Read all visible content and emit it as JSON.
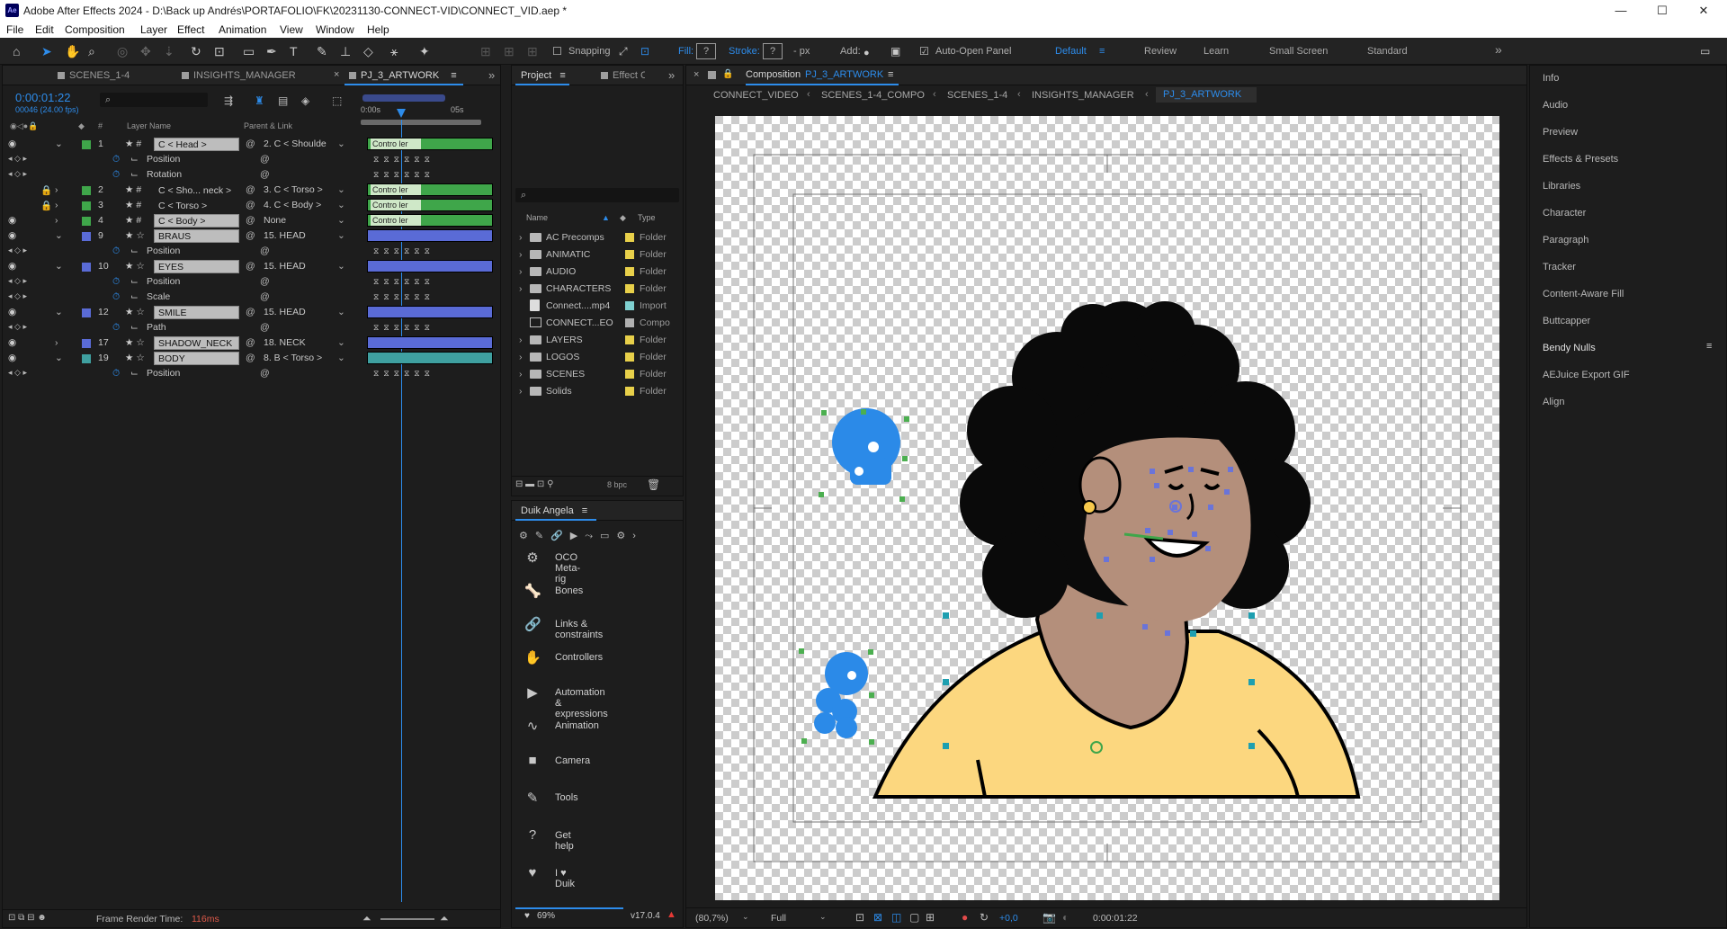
{
  "titlebar": {
    "app_icon": "Ae",
    "title": "Adobe After Effects 2024 - D:\\Back up Andrés\\PORTAFOLIO\\FK\\20231130-CONNECT-VID\\CONNECT_VID.aep *",
    "minimize": "—",
    "maximize": "☐",
    "close": "✕"
  },
  "menu": [
    "File",
    "Edit",
    "Composition",
    "Layer",
    "Effect",
    "Animation",
    "View",
    "Window",
    "Help"
  ],
  "toolbar": {
    "snapping": "Snapping",
    "fill": "Fill:",
    "fill_value": "?",
    "stroke": "Stroke:",
    "stroke_value": "?",
    "stroke_px": "- px",
    "add": "Add:",
    "auto_open": "Auto-Open Panel",
    "workspaces": [
      "Default",
      "Review",
      "Learn",
      "Small Screen",
      "Standard"
    ],
    "more": "»"
  },
  "timeline": {
    "tabs": [
      "SCENES_1-4",
      "INSIGHTS_MANAGER",
      "PJ_3_ARTWORK"
    ],
    "timecode": "0:00:01:22",
    "frame_info": "00046 (24.00 fps)",
    "col_layer_name": "Layer Name",
    "col_parent": "Parent & Link",
    "col_num": "#",
    "ruler": [
      "0:00s",
      "05s"
    ],
    "layers": [
      {
        "num": "1",
        "name": "C < Head >",
        "parent": "2. C < Shoulde",
        "type": "ctrl",
        "color": "#3fa64a",
        "bar": "Contro ler"
      },
      {
        "prop": "Position"
      },
      {
        "prop": "Rotation"
      },
      {
        "num": "2",
        "name": "C < Sho... neck >",
        "parent": "3. C < Torso >",
        "type": "ctrl",
        "color": "#3fa64a",
        "bar": "Contro ler",
        "plain": true
      },
      {
        "num": "3",
        "name": "C < Torso >",
        "parent": "4. C < Body >",
        "type": "ctrl",
        "color": "#3fa64a",
        "bar": "Contro ler",
        "plain": true
      },
      {
        "num": "4",
        "name": "C < Body >",
        "parent": "None",
        "type": "ctrl",
        "color": "#3fa64a",
        "bar": "Contro ler"
      },
      {
        "num": "9",
        "name": "BRAUS",
        "parent": "15. HEAD",
        "type": "shape",
        "color": "#5a6bd6"
      },
      {
        "prop": "Position"
      },
      {
        "num": "10",
        "name": "EYES",
        "parent": "15. HEAD",
        "type": "shape",
        "color": "#5a6bd6"
      },
      {
        "prop": "Position"
      },
      {
        "prop": "Scale"
      },
      {
        "num": "12",
        "name": "SMILE",
        "parent": "15. HEAD",
        "type": "shape",
        "color": "#5a6bd6"
      },
      {
        "prop": "Path"
      },
      {
        "num": "17",
        "name": "SHADOW_NECK",
        "parent": "18. NECK",
        "type": "shape",
        "color": "#5a6bd6"
      },
      {
        "num": "19",
        "name": "BODY",
        "parent": "8. B < Torso >",
        "type": "shape",
        "color": "#3fa0a0"
      },
      {
        "prop": "Position"
      }
    ],
    "footer": {
      "render_label": "Frame Render Time:",
      "render_value": "116ms"
    }
  },
  "project": {
    "tabs": [
      "Project",
      "Effect Controls"
    ],
    "search_placeholder": "",
    "col_name": "Name",
    "col_type": "Type",
    "items": [
      {
        "name": "AC Precomps",
        "type": "Folder",
        "color": "#e8d04a",
        "kind": "folder"
      },
      {
        "name": "ANIMATIC",
        "type": "Folder",
        "color": "#e8d04a",
        "kind": "folder"
      },
      {
        "name": "AUDIO",
        "type": "Folder",
        "color": "#e8d04a",
        "kind": "folder"
      },
      {
        "name": "CHARACTERS",
        "type": "Folder",
        "color": "#e8d04a",
        "kind": "folder"
      },
      {
        "name": "Connect....mp4",
        "type": "Import",
        "color": "#7fd0d0",
        "kind": "file"
      },
      {
        "name": "CONNECT...EO",
        "type": "Compo",
        "color": "#b0b0b0",
        "kind": "comp"
      },
      {
        "name": "LAYERS",
        "type": "Folder",
        "color": "#e8d04a",
        "kind": "folder"
      },
      {
        "name": "LOGOS",
        "type": "Folder",
        "color": "#e8d04a",
        "kind": "folder"
      },
      {
        "name": "SCENES",
        "type": "Folder",
        "color": "#e8d04a",
        "kind": "folder"
      },
      {
        "name": "Solids",
        "type": "Folder",
        "color": "#e8d04a",
        "kind": "folder"
      }
    ],
    "bpc": "8 bpc"
  },
  "duik": {
    "title": "Duik Angela",
    "items": [
      {
        "label": "OCO Meta-rig",
        "icon": "⚙"
      },
      {
        "label": "Bones",
        "icon": "🦴"
      },
      {
        "label": "Links & constraints",
        "icon": "🔗"
      },
      {
        "label": "Controllers",
        "icon": "✋"
      },
      {
        "label": "Automation & expressions",
        "icon": "▶"
      },
      {
        "label": "Animation",
        "icon": "∿"
      },
      {
        "label": "Camera",
        "icon": "■"
      },
      {
        "label": "Tools",
        "icon": "✎"
      },
      {
        "label": "Get help",
        "icon": "?"
      },
      {
        "label": "I ♥ Duik",
        "icon": "♥"
      }
    ],
    "footer_pct": "69%",
    "version": "v17.0.4"
  },
  "comp": {
    "tab_label": "Composition",
    "tab_name": "PJ_3_ARTWORK",
    "breadcrumbs": [
      "CONNECT_VIDEO",
      "SCENES_1-4_COMPO",
      "SCENES_1-4",
      "INSIGHTS_MANAGER",
      "PJ_3_ARTWORK"
    ],
    "zoom": "(80,7%)",
    "resolution": "Full",
    "exposure": "+0,0",
    "timecode": "0:00:01:22"
  },
  "right_panels": [
    "Info",
    "Audio",
    "Preview",
    "Effects & Presets",
    "Libraries",
    "Character",
    "Paragraph",
    "Tracker",
    "Content-Aware Fill",
    "Buttcapper",
    "Bendy Nulls",
    "AEJuice Export GIF",
    "Align"
  ],
  "colors": {
    "accent": "#2d8ceb",
    "skin": "#b48f7b",
    "shirt": "#fcd77f",
    "hair": "#0a0a0a",
    "skull": "#2b8ae8"
  }
}
